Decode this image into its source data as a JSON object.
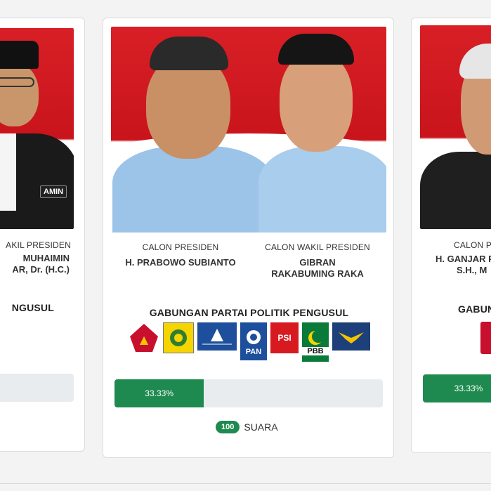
{
  "left_card": {
    "role_label": "AKIL PRESIDEN",
    "name_lines": [
      "MUHAIMIN",
      "AR, Dr. (H.C.)"
    ],
    "coalition_partial": "NGUSUL",
    "badge": "AMIN"
  },
  "center_card": {
    "president_role": "CALON PRESIDEN",
    "president_name": "H. PRABOWO SUBIANTO",
    "vp_role": "CALON WAKIL PRESIDEN",
    "vp_name": "GIBRAN RAKABUMING RAKA",
    "coalition_title": "GABUNGAN PARTAI POLITIK PENGUSUL",
    "party_logos": [
      {
        "icon": "gerindra-logo-icon",
        "text": "GERINDRA",
        "color": "#c8102e"
      },
      {
        "icon": "golkar-logo-icon",
        "text": "",
        "color": "#f5d400"
      },
      {
        "icon": "demokrat-logo-icon",
        "text": "PARTAI DEMOKRAT",
        "color": "#1d4f9c"
      },
      {
        "icon": "pan-logo-icon",
        "text": "PAN",
        "color": "#1d4f9c"
      },
      {
        "icon": "psi-logo-icon",
        "text": "PSI",
        "color": "#d71920"
      },
      {
        "icon": "pbb-logo-icon",
        "text": "PBB",
        "color": "#0a7a3a"
      },
      {
        "icon": "garuda-logo-icon",
        "text": "GARUDA",
        "color": "#1d3f7a"
      }
    ],
    "progress_label": "33.33%",
    "progress_fraction": 0.3333,
    "vote_count": "100",
    "vote_unit": "SUARA"
  },
  "right_card": {
    "role_label": "CALON P",
    "name_lines": [
      "H. GANJAR P",
      "S.H., M"
    ],
    "coalition_partial": "GABUN",
    "progress_label": "33.33%",
    "progress_fraction": 0.3333
  },
  "colors": {
    "accent_green": "#1e8a4f",
    "photo_red": "#d81f26",
    "bar_bg": "#e9ecef"
  }
}
